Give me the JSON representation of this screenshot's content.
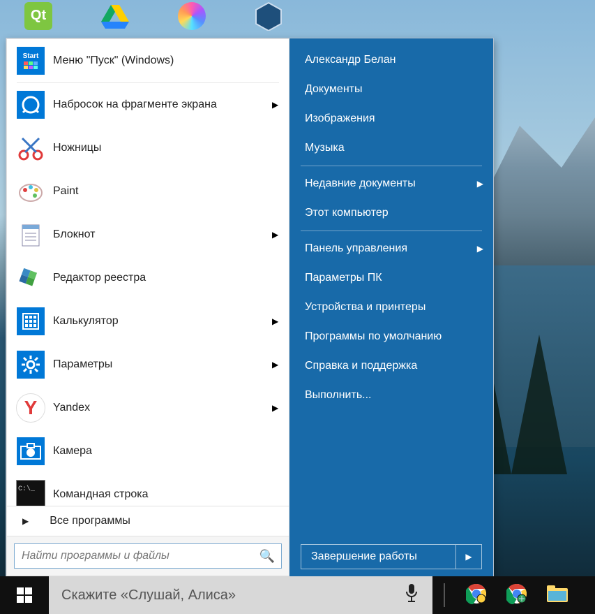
{
  "desktop_icons": [
    "qt-icon",
    "drive-icon",
    "krita-icon",
    "virtualbox-icon"
  ],
  "start_menu": {
    "left": [
      {
        "label": "Меню \"Пуск\" (Windows)",
        "icon": "start-icon",
        "arrow": false
      },
      {
        "label": "Набросок на фрагменте экрана",
        "icon": "snip-icon",
        "arrow": true
      },
      {
        "label": "Ножницы",
        "icon": "scissors-icon",
        "arrow": false
      },
      {
        "label": "Paint",
        "icon": "paint-icon",
        "arrow": false
      },
      {
        "label": "Блокнот",
        "icon": "notepad-icon",
        "arrow": true
      },
      {
        "label": "Редактор реестра",
        "icon": "regedit-icon",
        "arrow": false
      },
      {
        "label": "Калькулятор",
        "icon": "calculator-icon",
        "arrow": true
      },
      {
        "label": "Параметры",
        "icon": "settings-icon",
        "arrow": true
      },
      {
        "label": "Yandex",
        "icon": "yandex-icon",
        "arrow": true
      },
      {
        "label": "Камера",
        "icon": "camera-icon",
        "arrow": false
      },
      {
        "label": "Командная строка",
        "icon": "cmd-icon",
        "arrow": false
      }
    ],
    "all_programs": "Все программы",
    "search_placeholder": "Найти программы и файлы",
    "right": [
      {
        "label": "Александр Белан",
        "arrow": false
      },
      {
        "label": "Документы",
        "arrow": false
      },
      {
        "label": "Изображения",
        "arrow": false
      },
      {
        "label": "Музыка",
        "arrow": false
      },
      {
        "sep": true
      },
      {
        "label": "Недавние документы",
        "arrow": true
      },
      {
        "label": "Этот компьютер",
        "arrow": false
      },
      {
        "sep": true
      },
      {
        "label": "Панель управления",
        "arrow": true
      },
      {
        "label": "Параметры ПК",
        "arrow": false
      },
      {
        "label": "Устройства и принтеры",
        "arrow": false
      },
      {
        "label": "Программы по умолчанию",
        "arrow": false
      },
      {
        "label": "Справка и поддержка",
        "arrow": false
      },
      {
        "label": "Выполнить...",
        "arrow": false
      }
    ],
    "shutdown": "Завершение работы"
  },
  "taskbar": {
    "cortana_placeholder": "Скажите «Слушай, Алиса»",
    "pinned": [
      "chrome-icon",
      "chrome-earth-icon",
      "explorer-icon"
    ]
  }
}
